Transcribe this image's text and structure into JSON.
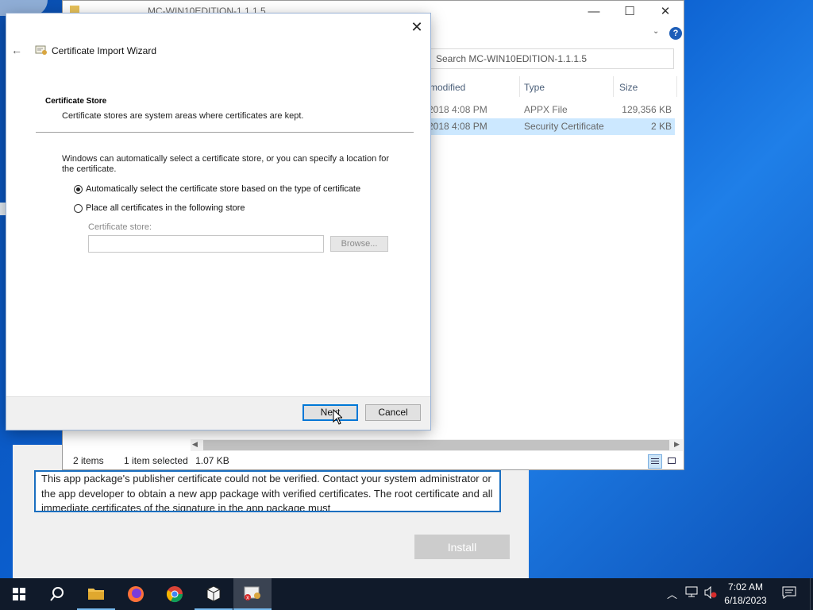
{
  "explorer": {
    "title": "MC-WIN10EDITION-1.1.1.5",
    "search_placeholder": "Search MC-WIN10EDITION-1.1.1.5",
    "columns": {
      "modified": "modified",
      "type": "Type",
      "size": "Size"
    },
    "rows": [
      {
        "modified": "2018 4:08 PM",
        "type": "APPX File",
        "size": "129,356 KB"
      },
      {
        "modified": "2018 4:08 PM",
        "type": "Security Certificate",
        "size": "2 KB"
      }
    ],
    "status": {
      "items": "2 items",
      "selected": "1 item selected",
      "size": "1.07 KB"
    }
  },
  "installer": {
    "message": "This app package's publisher certificate could not be verified. Contact your system administrator or the app developer to obtain a new app package with verified certificates. The root certificate and all immediate certificates of the signature in the app package must",
    "install_label": "Install"
  },
  "wizard": {
    "title": "Certificate Import Wizard",
    "section_title": "Certificate Store",
    "section_desc": "Certificate stores are system areas where certificates are kept.",
    "body": "Windows can automatically select a certificate store, or you can specify a location for the certificate.",
    "option_auto": "Automatically select the certificate store based on the type of certificate",
    "option_manual": "Place all certificates in the following store",
    "store_label": "Certificate store:",
    "store_value": "",
    "browse_label": "Browse...",
    "next_label": "Next",
    "cancel_label": "Cancel",
    "selected_option": "auto"
  },
  "taskbar": {
    "time": "7:02 AM",
    "date": "6/18/2023",
    "icons": [
      "windows-start-icon",
      "search-icon",
      "file-explorer-icon",
      "firefox-icon",
      "chrome-icon",
      "package-icon",
      "certificate-app-icon"
    ]
  }
}
